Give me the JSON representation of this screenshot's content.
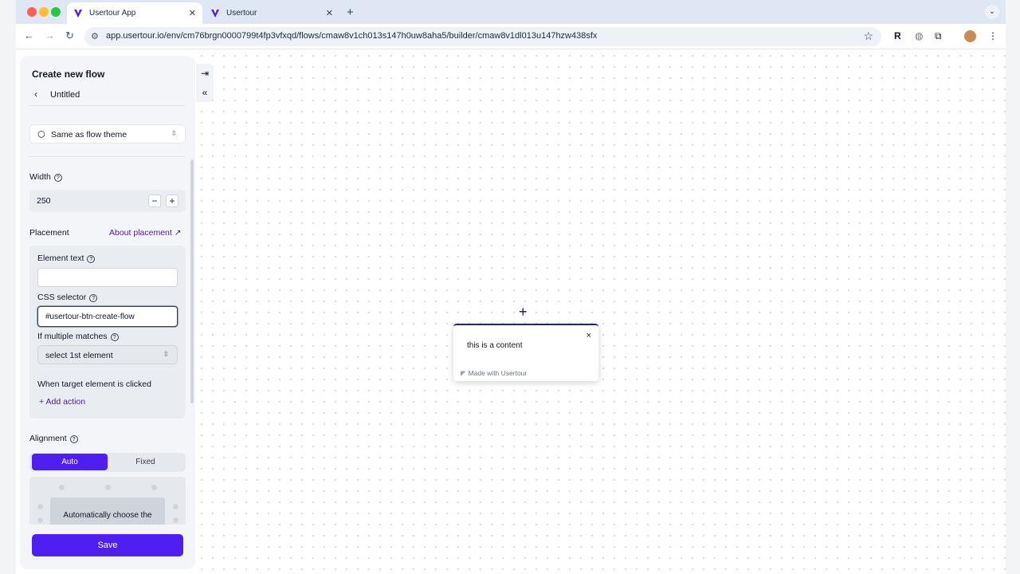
{
  "browser": {
    "tabs": [
      {
        "title": "Usertour App",
        "active": true
      },
      {
        "title": "Usertour",
        "active": false
      }
    ],
    "new_tab_icon": "+",
    "tab_menu_icon": "⌄",
    "url": "app.usertour.io/env/cm76brgn0000799t4fp3vfxqd/flows/cmaw8v1ch013s147h0uw8aha5/builder/cmaw8v1dl013u147hzw438sfx",
    "extension_label": "R",
    "colors": {
      "tabstrip": "#dfe7f5",
      "red": "#ff5f57",
      "yellow": "#febc2e",
      "green": "#28c840",
      "brand": "#4f1ff2"
    }
  },
  "sidebar": {
    "title": "Create new flow",
    "step_name": "Untitled",
    "theme_select": "Same as flow theme",
    "width_label": "Width",
    "width_value": "250",
    "placement_label": "Placement",
    "about_placement": "About placement",
    "element_text_label": "Element text",
    "element_text_value": "",
    "css_selector_label": "CSS selector",
    "css_selector_value": "#usertour-btn-create-flow",
    "multiple_matches_label": "If multiple matches",
    "multiple_matches_value": "select 1st element",
    "clicked_label": "When target element is clicked",
    "add_action": "+ Add action",
    "alignment_label": "Alignment",
    "alignment_options": [
      "Auto",
      "Fixed"
    ],
    "alignment_selected": "Auto",
    "auto_hint": "Automatically choose the",
    "save_label": "Save"
  },
  "canvas": {
    "popup_content": "this is a content",
    "popup_branding": "Made with Usertour",
    "popup_close": "×"
  }
}
